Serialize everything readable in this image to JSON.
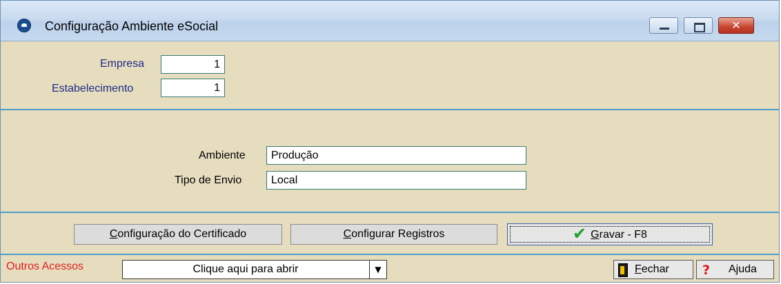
{
  "window": {
    "title": "Configuração Ambiente eSocial",
    "close_glyph": "✕"
  },
  "form": {
    "empresa_label": "Empresa",
    "empresa_value": "1",
    "estabelecimento_label": "Estabelecimento",
    "estabelecimento_value": "1",
    "ambiente_label": "Ambiente",
    "ambiente_value": "Produção",
    "tipo_envio_label": "Tipo de Envio",
    "tipo_envio_value": "Local"
  },
  "buttons": {
    "certificado_first": "C",
    "certificado_rest": "onfiguração do Certificado",
    "registros_first": "C",
    "registros_rest": "onfigurar Registros",
    "gravar_first": "G",
    "gravar_rest": "ravar - F8"
  },
  "footer": {
    "outros_acessos": "Outros Acessos",
    "select_value": "Clique aqui para abrir",
    "fechar_first": "F",
    "fechar_rest": "echar",
    "ajuda": "Ajuda"
  },
  "icons": {
    "app": "esocial-app-icon",
    "check": "checkmark-icon",
    "door": "door-exit-icon",
    "help": "question-icon",
    "dropdown": "chevron-down-icon"
  },
  "colors": {
    "background": "#e6dcbe",
    "divider": "#4d9bc9",
    "label_blue": "#1e2a86",
    "outros_red": "#e02020",
    "check_green": "#1f9e2a"
  }
}
